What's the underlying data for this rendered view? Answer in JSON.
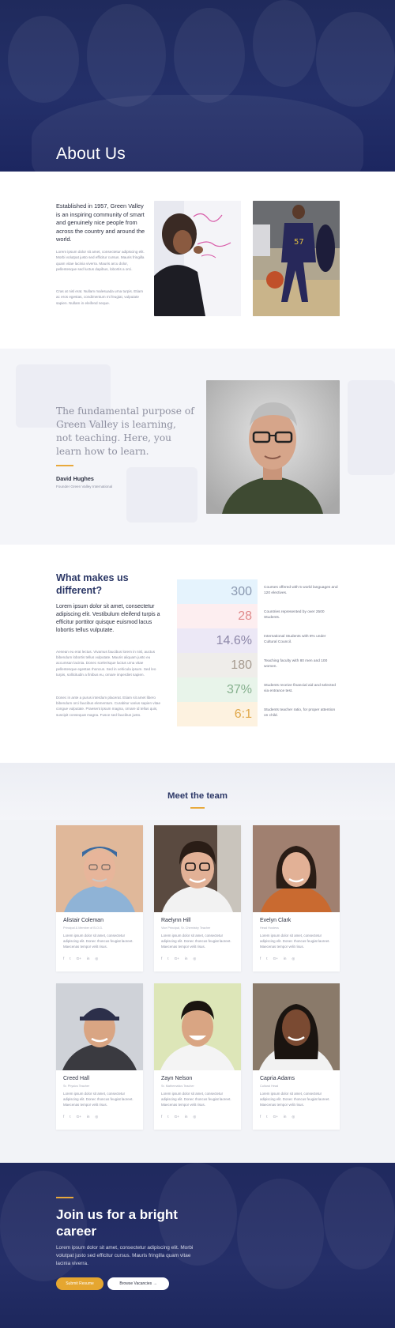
{
  "hero": {
    "title": "About Us"
  },
  "about": {
    "intro": "Established in 1957, Green Valley is an inspiring community of smart and genuinely nice people from across the country and around the world.",
    "p1": "Lorem ipsum dolor sit amet, consectetur adipiscing elit. Morbi volutpat justo sed efficitur cursus. Mauris fringilla quam vitae lacinia viverra. Mauris arcu dolor, pellentesque sed luctus dapibus, lobortis a orci.",
    "p2": "Cras at nisl erat. Nullam malesuada urna turpis. Etiam ac eros egestas, condimentum mi feugiat, vulputate sapien. Nullam in eleifend neque."
  },
  "quote": {
    "text": "The fundamental purpose of Green Valley is learning, not teaching. Here, you learn how to learn.",
    "name": "David Hughes",
    "role": "Founder Green Valley International"
  },
  "different": {
    "title": "What makes us different?",
    "lead": "Lorem ipsum dolor sit amet, consectetur adipiscing elit. Vestibulum eleifend turpis a efficitur porttitor quisque euismod lacus lobortis tellus vulputate.",
    "p1": "Aenean eu erat lectus. Vivamus faucibus lorem in nisl, auctus bibendum lobortis tellus vulputate. Mauris aliquam justo eu accumsan lacinia. Donec scelerisque luctus urna vitae pellentesque egestas rhoncus. Sed in vehicula ipsum. Sed leo turpis, sollicitudin a finibus eu, ornare imperdiet sapien.",
    "p2": "Donec in ante a purus interdum placerat. Etiam sit amet libero bibendum orci faucibus elementum. Curabitur varius sapien vitae congue vulputate. Praesent ipsum magna, ornare id tellus quis, suscipit consequat magna. Fusce sed faucibus justo.",
    "stats": [
      {
        "value": "300",
        "label": "Courses offered with 5 world languages and 120 electives.",
        "bg": "#e5f3fd",
        "color": "#8a98b0"
      },
      {
        "value": "28",
        "label": "Countries represented by over 2500 Students.",
        "bg": "#fdeef0",
        "color": "#e08a8a"
      },
      {
        "value": "14.6%",
        "label": "International Students with 8% under Cultural Council.",
        "bg": "#ece8f6",
        "color": "#8d87a8"
      },
      {
        "value": "180",
        "label": "Teaching faculty with 80 men and 100 women.",
        "bg": "#efedea",
        "color": "#a69b90"
      },
      {
        "value": "37%",
        "label": "Students receive financial aid and selected via entrance test.",
        "bg": "#e8f4ea",
        "color": "#86b08e"
      },
      {
        "value": "6:1",
        "label": "Students teacher ratio, for proper attention on child.",
        "bg": "#fdf2e0",
        "color": "#e0a84a"
      }
    ]
  },
  "team": {
    "title": "Meet the team",
    "members": [
      {
        "name": "Alistair Coleman",
        "role": "Principal & Member of B.O.G.",
        "bio": "Lorem ipsum dolor sit amet, consectetur adipiscing elit. Donec rhoncus feugiat laoreet. Maecenas tempor velit risus."
      },
      {
        "name": "Raelynn Hill",
        "role": "Vice Principal, Sr. Chemistry Teacher",
        "bio": "Lorem ipsum dolor sit amet, consectetur adipiscing elit. Donec rhoncus feugiat laoreet. Maecenas tempor velit risus."
      },
      {
        "name": "Evelyn Clark",
        "role": "Head Hostess",
        "bio": "Lorem ipsum dolor sit amet, consectetur adipiscing elit. Donec rhoncus feugiat laoreet. Maecenas tempor velit risus."
      },
      {
        "name": "Creed Hall",
        "role": "Sr. Physics Teacher",
        "bio": "Lorem ipsum dolor sit amet, consectetur adipiscing elit. Donec rhoncus feugiat laoreet. Maecenas tempor velit risus."
      },
      {
        "name": "Zayn Nelson",
        "role": "Sr. Mathematics Teacher",
        "bio": "Lorem ipsum dolor sit amet, consectetur adipiscing elit. Donec rhoncus feugiat laoreet. Maecenas tempor velit risus."
      },
      {
        "name": "Capria Adams",
        "role": "Cultural Head",
        "bio": "Lorem ipsum dolor sit amet, consectetur adipiscing elit. Donec rhoncus feugiat laoreet. Maecenas tempor velit risus."
      }
    ],
    "social_icons": [
      "f",
      "t",
      "G+",
      "in",
      "◎"
    ]
  },
  "cta": {
    "title": "Join us for a bright career",
    "text": "Lorem ipsum dolor sit amet, consectetur adipiscing elit. Morbi volutpat justo sed efficitur cursus. Mauris fringilla quam vitae lacinia viverra.",
    "primary_label": "Submit Resume",
    "secondary_label": "Browse Vacancies  →"
  },
  "colors": {
    "navy": "#24306a",
    "accent": "#e8a93c",
    "heading": "#2b3766"
  }
}
